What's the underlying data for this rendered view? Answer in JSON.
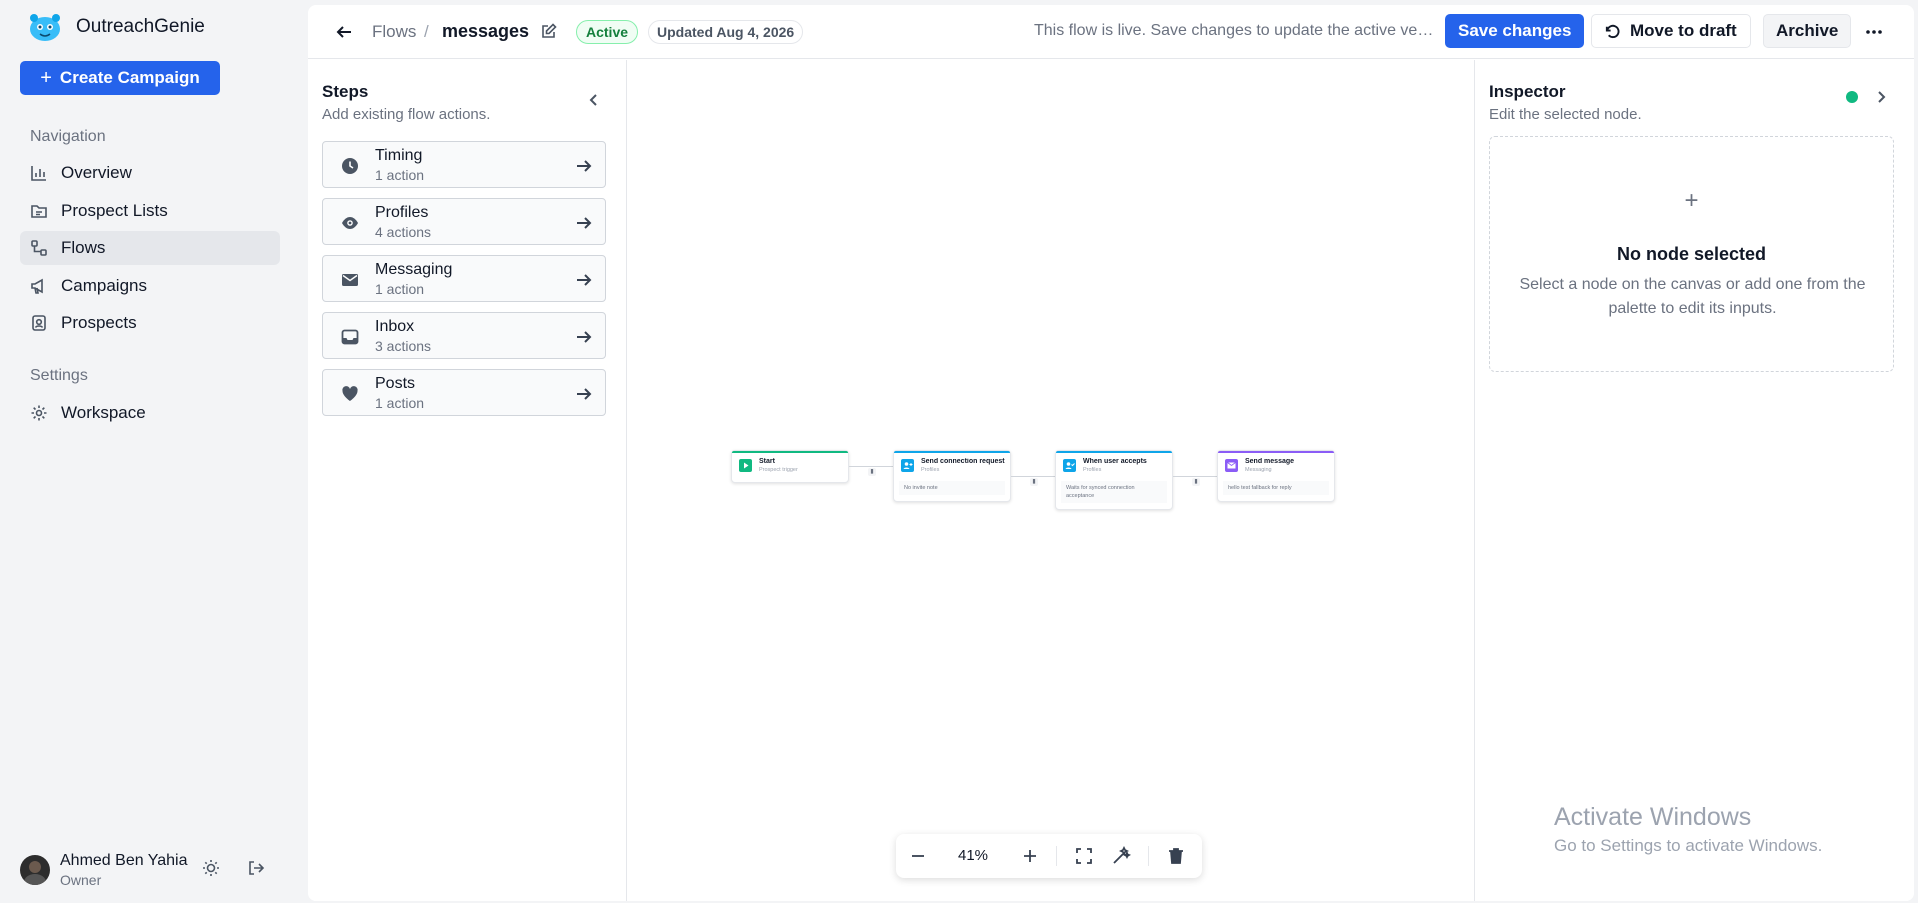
{
  "app": {
    "name": "OutreachGenie",
    "create_label": "Create Campaign"
  },
  "sidebar": {
    "nav_heading": "Navigation",
    "nav_items": [
      {
        "label": "Overview",
        "icon": "bar-chart-icon"
      },
      {
        "label": "Prospect Lists",
        "icon": "folder-list-icon"
      },
      {
        "label": "Flows",
        "icon": "flow-icon",
        "active": true
      },
      {
        "label": "Campaigns",
        "icon": "megaphone-icon"
      },
      {
        "label": "Prospects",
        "icon": "contact-card-icon"
      }
    ],
    "settings_heading": "Settings",
    "settings_items": [
      {
        "label": "Workspace",
        "icon": "gear-icon"
      }
    ],
    "user": {
      "name": "Ahmed Ben Yahia",
      "role": "Owner"
    }
  },
  "header": {
    "breadcrumb_root": "Flows",
    "breadcrumb_sep": "/",
    "flow_name": "messages",
    "status": "Active",
    "updated": "Updated Aug 4, 2026",
    "live_note": "This flow is live. Save changes to update the active version.",
    "save_label": "Save changes",
    "draft_label": "Move to draft",
    "archive_label": "Archive"
  },
  "steps": {
    "title": "Steps",
    "subtitle": "Add existing flow actions.",
    "items": [
      {
        "name": "Timing",
        "count": "1 action",
        "icon": "clock-icon"
      },
      {
        "name": "Profiles",
        "count": "4 actions",
        "icon": "eye-icon"
      },
      {
        "name": "Messaging",
        "count": "1 action",
        "icon": "mail-icon"
      },
      {
        "name": "Inbox",
        "count": "3 actions",
        "icon": "inbox-icon"
      },
      {
        "name": "Posts",
        "count": "1 action",
        "icon": "heart-icon"
      }
    ]
  },
  "canvas": {
    "nodes": [
      {
        "title": "Start",
        "subtitle": "Prospect trigger",
        "body": "",
        "accent": "#10b981",
        "icon_color": "#10b981"
      },
      {
        "title": "Send connection request",
        "subtitle": "Profiles",
        "body": "No invite note",
        "accent": "#0ea5e9",
        "icon_color": "#0ea5e9"
      },
      {
        "title": "When user accepts",
        "subtitle": "Profiles",
        "body": "Waits for synced connection acceptance",
        "accent": "#0ea5e9",
        "icon_color": "#0ea5e9"
      },
      {
        "title": "Send message",
        "subtitle": "Messaging",
        "body": "hello test fallback for reply",
        "accent": "#8b5cf6",
        "icon_color": "#8b5cf6"
      }
    ],
    "zoom": "41%"
  },
  "inspector": {
    "title": "Inspector",
    "subtitle": "Edit the selected node.",
    "empty_plus": "+",
    "empty_title": "No node selected",
    "empty_desc": "Select a node on the canvas or add one from the palette to edit its inputs."
  },
  "watermark": {
    "title": "Activate Windows",
    "subtitle": "Go to Settings to activate Windows."
  },
  "colors": {
    "primary": "#2563eb",
    "active_badge": "#15803d",
    "status_dot": "#10b981"
  }
}
